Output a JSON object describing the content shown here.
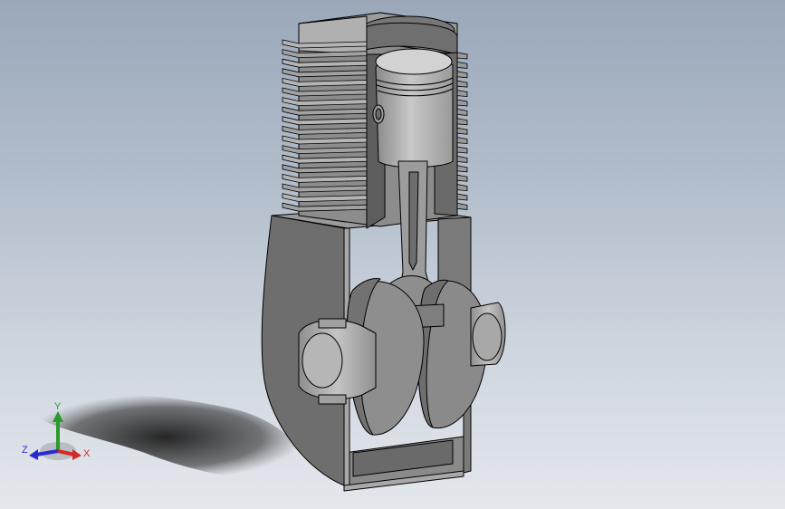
{
  "viewport": {
    "background_top": "#9aa8ba",
    "background_bottom": "#e4e8ed"
  },
  "model": {
    "part_fill": "#a6a6a6",
    "cut_face_fill": "#7e7e7e",
    "edge_color": "#000000"
  },
  "triad": {
    "x_label": "X",
    "y_label": "Y",
    "z_label": "Z",
    "x_color": "#d42a2a",
    "y_color": "#2a9a2a",
    "z_color": "#2a2ad4"
  }
}
